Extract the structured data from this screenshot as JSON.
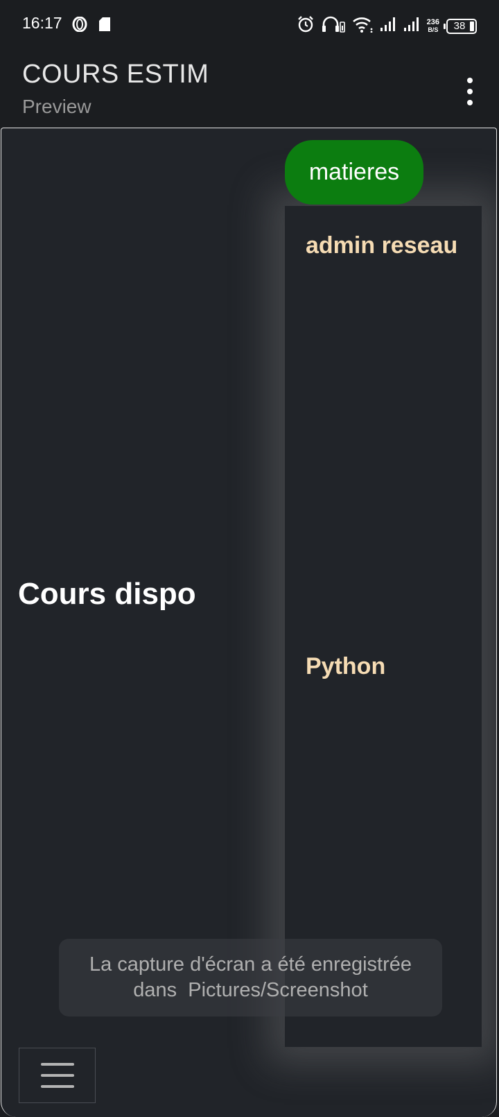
{
  "status_bar": {
    "time": "16:17",
    "net_speed_value": "236",
    "net_speed_unit": "B/S",
    "battery": "38",
    "icons": [
      "opera-icon",
      "sd-card-icon",
      "alarm-icon",
      "headphones-icon",
      "wifi-icon",
      "signal-icon",
      "signal-icon"
    ]
  },
  "app_bar": {
    "title": "COURS ESTIM",
    "subtitle": "Preview",
    "menu_icon": "more-vert-icon"
  },
  "main": {
    "heading": "Cours dispo",
    "matieres_button_label": "matieres",
    "dropdown_items": [
      {
        "label": "admin reseau"
      },
      {
        "label": "Python"
      }
    ],
    "nav_toggle_icon": "hamburger-icon"
  },
  "toast": {
    "line1": "La capture d'écran a été enregistrée",
    "line2": "dans  Pictures/Screenshot"
  },
  "colors": {
    "background": "#212429",
    "app_bar": "#1b1d20",
    "button_green": "#0c7d10",
    "menu_item_text": "#f6dcb4"
  }
}
